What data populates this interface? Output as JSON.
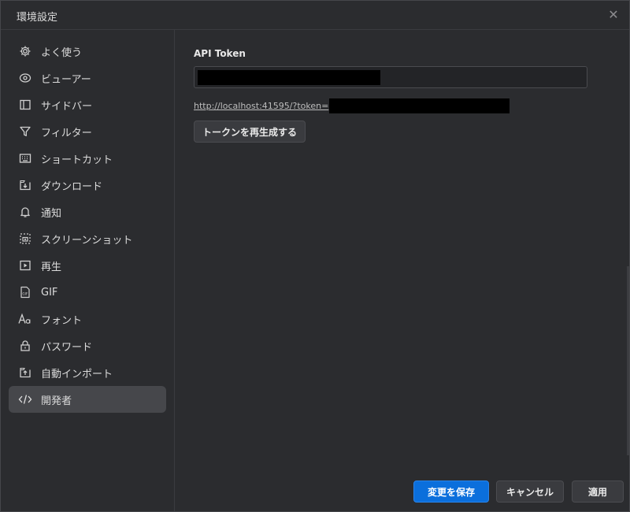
{
  "window": {
    "title": "環境設定"
  },
  "sidebar": {
    "items": [
      {
        "label": "よく使う",
        "icon": "gear-icon"
      },
      {
        "label": "ビューアー",
        "icon": "eye-icon"
      },
      {
        "label": "サイドバー",
        "icon": "sidebar-icon"
      },
      {
        "label": "フィルター",
        "icon": "filter-icon"
      },
      {
        "label": "ショートカット",
        "icon": "keyboard-icon"
      },
      {
        "label": "ダウンロード",
        "icon": "download-icon"
      },
      {
        "label": "通知",
        "icon": "bell-icon"
      },
      {
        "label": "スクリーンショット",
        "icon": "screenshot-icon"
      },
      {
        "label": "再生",
        "icon": "play-icon"
      },
      {
        "label": "GIF",
        "icon": "gif-icon"
      },
      {
        "label": "フォント",
        "icon": "font-icon"
      },
      {
        "label": "パスワード",
        "icon": "lock-icon"
      },
      {
        "label": "自動インポート",
        "icon": "import-icon"
      },
      {
        "label": "開発者",
        "icon": "code-icon",
        "active": true
      }
    ]
  },
  "developer": {
    "api_token_label": "API Token",
    "url_prefix": "http://localhost:41595/?token=",
    "regenerate_button": "トークンを再生成する"
  },
  "footer": {
    "save_label": "変更を保存",
    "cancel_label": "キャンセル",
    "apply_label": "適用"
  },
  "colors": {
    "accent": "#0b6fdc",
    "background": "#2b2c2f",
    "active_item": "#46474b"
  }
}
